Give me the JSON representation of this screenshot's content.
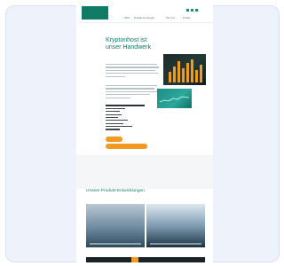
{
  "header": {
    "logo_text": "",
    "util_links": [
      "",
      ""
    ],
    "nav_items": [
      "Home",
      "Produkte & Lösungen",
      "Über uns",
      "Kontakt"
    ],
    "brand_color": "#0f7a66",
    "accent_color": "#f29a1f"
  },
  "main": {
    "breadcrumb": "",
    "headline": "Kryptonhost ist unser Handwerk",
    "side_tab": "",
    "cta_primary": "",
    "cta_secondary": ""
  },
  "section": {
    "title": "Unsere Produkt-Entwicklungen"
  }
}
